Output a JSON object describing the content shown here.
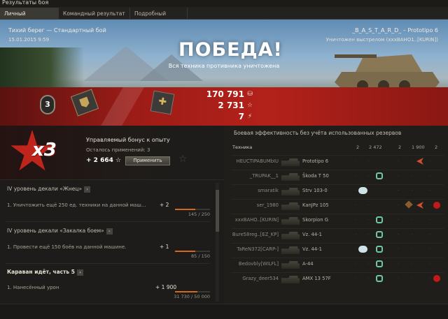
{
  "window": {
    "title": "Результаты боя"
  },
  "tabs": [
    {
      "label": "Личный результат",
      "active": true
    },
    {
      "label": "Командный результат",
      "active": false
    },
    {
      "label": "Подробный отчёт",
      "active": false
    }
  ],
  "header": {
    "map_mode": "Тихий берег — Стандартный бой",
    "datetime": "15.01.2015 9:59",
    "player_vehicle": "_B_A_S_T_A_R_D_ – Prototipo 6",
    "destroyed_by": "Уничтожен выстрелом (xxxBAHO1..[KURIN])",
    "result": "ПОБЕДА!",
    "result_sub": "Вся техника противника уничтожена"
  },
  "badges": {
    "mastery_level": "3"
  },
  "totals": [
    {
      "value": "170 791",
      "icon": "credits-icon",
      "glyph": "⛁"
    },
    {
      "value": "2 731",
      "icon": "experience-star-icon",
      "glyph": "☆"
    },
    {
      "value": "7",
      "icon": "free-xp-icon",
      "glyph": "⚡"
    }
  ],
  "bonus": {
    "multiplier": "x3",
    "title": "Управляемый бонус к опыту",
    "remaining": "Осталось применений: 3",
    "value": "+ 2 664 ☆",
    "apply_label": "Применить"
  },
  "missions": [
    {
      "title": "IV уровень декали «Жнец»",
      "task": "1. Уничтожить ещё 250 ед. техники на данной маш...",
      "gain": "+ 2",
      "progress_text": "145 / 250",
      "progress": 0.58
    },
    {
      "title": "IV уровень декали «Закалка боем»",
      "task": "1. Провести ещё 150 боёв на данной машине.",
      "gain": "+ 1",
      "progress_text": "85 / 150",
      "progress": 0.57
    },
    {
      "title": "Караван идёт, часть 5",
      "task": "1. Нанесённый урон",
      "gain": "+ 1 900",
      "progress_text": "31 730 / 50 000",
      "progress": 0.63
    }
  ],
  "efficiency": {
    "title": "Боевая эффективность без учёта использованных резервов",
    "col_vehicle": "Техника",
    "col_vals": [
      "2",
      "2 472",
      "2",
      "1 900",
      "2"
    ],
    "rows": [
      {
        "player": "HEUCTIPABUMbIU",
        "tank": "Prototipo 6",
        "icons": [
          "dmg"
        ]
      },
      {
        "player": "_TRUPAK__1",
        "tank": "Škoda T 50",
        "icons": [
          "link"
        ]
      },
      {
        "player": "smaratik",
        "tank": "Strv 103-0",
        "icons": [
          "bin"
        ]
      },
      {
        "player": "ser_1980",
        "tank": "KanJPz 105",
        "icons": [
          "track",
          "dmg",
          "kill"
        ]
      },
      {
        "player": "xxxBAHO..[KURIN]",
        "tank": "Skorpion G",
        "icons": [
          "link"
        ]
      },
      {
        "player": "Bure58reg..[EZ_KP]",
        "tank": "Vz. 44-1",
        "icons": [
          "link"
        ]
      },
      {
        "player": "TaReN372[CARP-]",
        "tank": "Vz. 44-1",
        "icons": [
          "bin",
          "link"
        ]
      },
      {
        "player": "Bedovbly[WILFL]",
        "tank": "A-44",
        "icons": [
          "link"
        ]
      },
      {
        "player": "Grazy_deer534",
        "tank": "AMX 13 57F",
        "icons": [
          "link",
          "kill"
        ]
      }
    ]
  }
}
